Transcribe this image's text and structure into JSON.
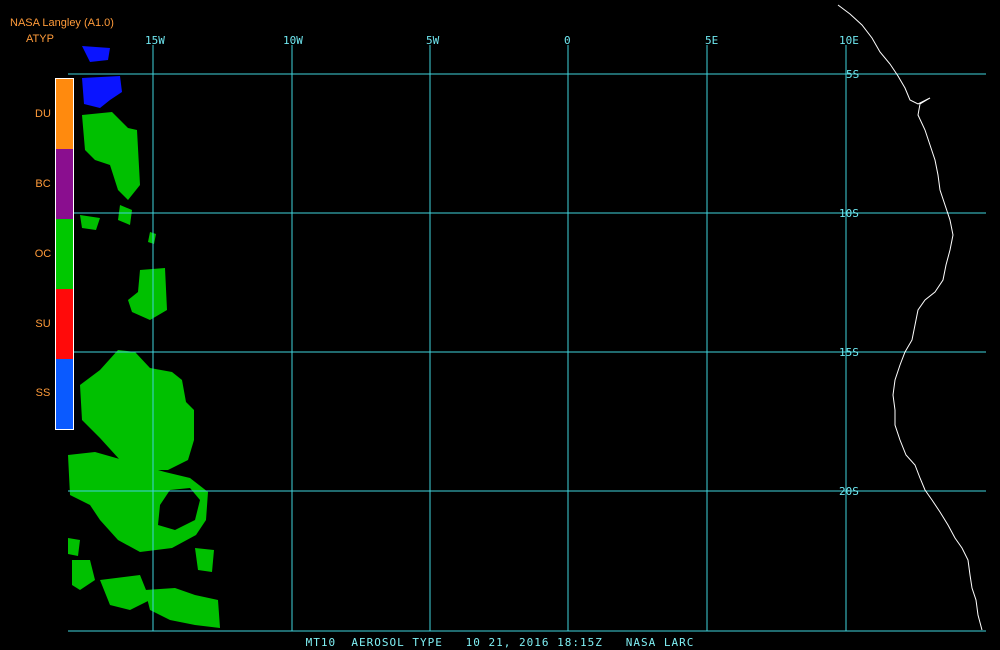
{
  "header": {
    "source": "NASA Langley (A1.0)",
    "product": "ATYP"
  },
  "legend": [
    {
      "label": "DU",
      "color": "#ff8a0e"
    },
    {
      "label": "BC",
      "color": "#8a0e8f"
    },
    {
      "label": "OC",
      "color": "#00c800"
    },
    {
      "label": "SU",
      "color": "#ff0a0a"
    },
    {
      "label": "SS",
      "color": "#0a5aff"
    }
  ],
  "grid": {
    "lon_labels": [
      "15W",
      "10W",
      "5W",
      "0",
      "5E",
      "10E"
    ],
    "lat_labels": [
      "5S",
      "10S",
      "15S",
      "20S"
    ],
    "color": "#40d4dc"
  },
  "footer": "MT10  AEROSOL TYPE   10 21, 2016 18:15Z   NASA LARC",
  "colors": {
    "background": "#000000",
    "coastline": "#ffffff",
    "text_header": "#ff9b3a"
  }
}
